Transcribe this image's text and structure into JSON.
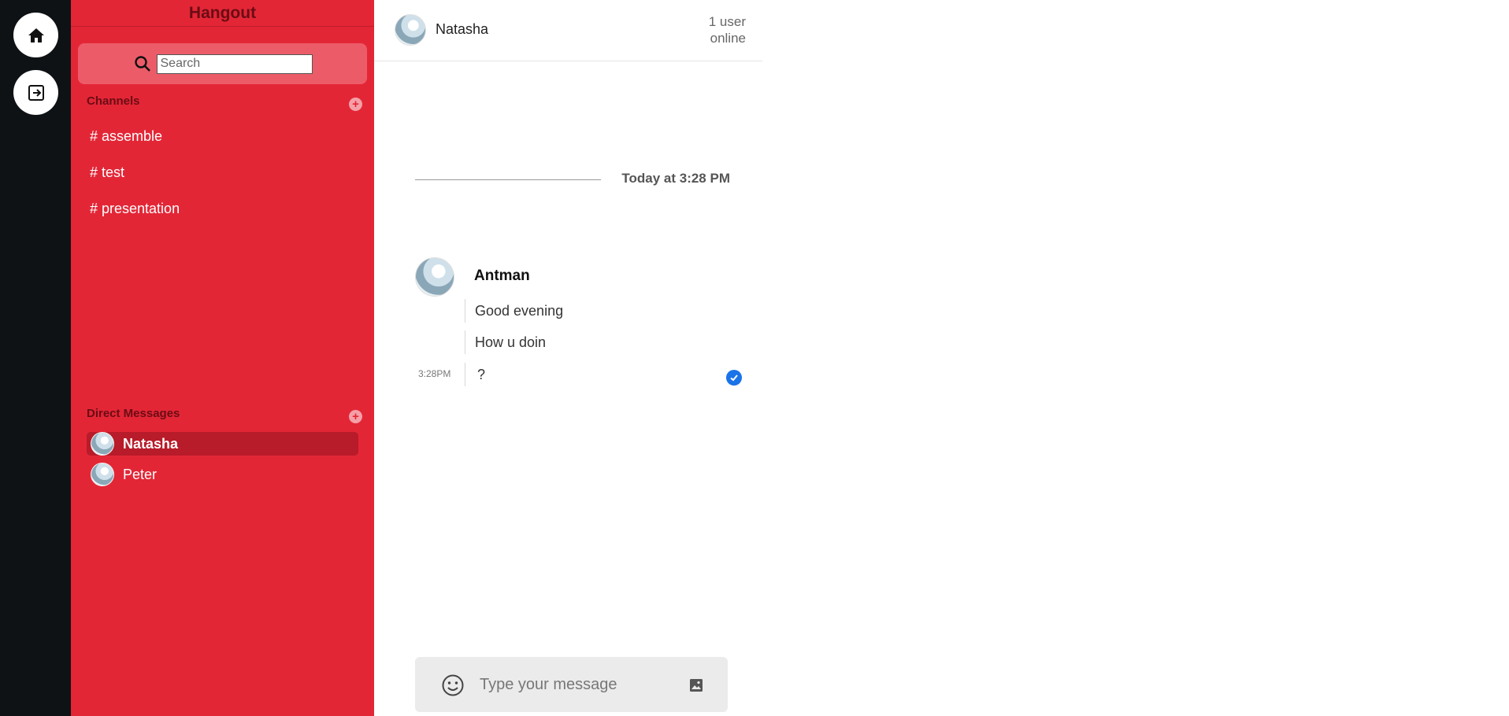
{
  "rail": {
    "home_icon": "home-icon",
    "logout_icon": "logout-icon"
  },
  "sidebar": {
    "title": "Hangout",
    "search": {
      "placeholder": "Search",
      "value": ""
    },
    "channels_label": "Channels",
    "channels": [
      {
        "label": "# assemble"
      },
      {
        "label": "# test"
      },
      {
        "label": "# presentation"
      }
    ],
    "dms_label": "Direct Messages",
    "dms": [
      {
        "name": "Natasha",
        "active": true
      },
      {
        "name": "Peter",
        "active": false
      }
    ]
  },
  "chat": {
    "header": {
      "name": "Natasha",
      "status_line1": "1 user",
      "status_line2": "online"
    },
    "date_divider": "Today at 3:28 PM",
    "message_group": {
      "author": "Antman",
      "lines": [
        "Good evening",
        "How u doin",
        "?"
      ],
      "time": "3:28PM",
      "read": true
    },
    "composer": {
      "placeholder": "Type your message",
      "value": ""
    }
  },
  "colors": {
    "rail": "#0e1215",
    "sidebar": "#e32636",
    "active_dm": "#b81b29",
    "read_check": "#1a73e8"
  }
}
